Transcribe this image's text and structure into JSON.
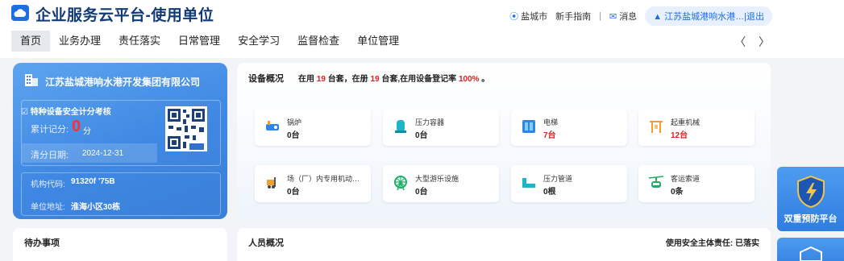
{
  "header": {
    "title": "企业服务云平台-使用单位",
    "location": "盐城市",
    "guide": "新手指南",
    "separator": "|",
    "message": "消息",
    "user": "江苏盐城港响水港…",
    "logout": "|退出"
  },
  "nav": {
    "items": [
      "首页",
      "业务办理",
      "责任落实",
      "日常管理",
      "安全学习",
      "监督检查",
      "单位管理"
    ],
    "arrows": "〈 〉"
  },
  "company": {
    "name": "江苏盐城港响水港开发集团有限公司",
    "assess_title": "特种设备安全计分考核",
    "score_label": "累计记分:",
    "score_value": "0",
    "score_unit": "分",
    "clear_label": "清分日期:",
    "clear_date": "2024-12-31",
    "org_label": "机构代码:",
    "org_code": "91320f        '75B",
    "addr_label": "单位地址:",
    "addr_value": "淮海小区30栋"
  },
  "equipment": {
    "title": "设备概况",
    "summary_prefix": "在用",
    "in_use": "19",
    "summary_mid1": "台套，在册",
    "registered": "19",
    "summary_mid2": "台套,在用设备登记率",
    "rate": "100%",
    "summary_suffix": "。"
  },
  "chart_data": {
    "type": "table",
    "categories": [
      "锅炉",
      "压力容器",
      "电梯",
      "起重机械",
      "场（厂）内专用机动…",
      "大型游乐设施",
      "压力管道",
      "客运索道"
    ],
    "values": [
      0,
      0,
      7,
      12,
      0,
      0,
      0,
      0
    ],
    "counts": [
      "0台",
      "0台",
      "7台",
      "12台",
      "0台",
      "0台",
      "0根",
      "0条"
    ],
    "highlight_color": "#e02020"
  },
  "todo": {
    "title": "待办事项"
  },
  "personnel": {
    "title": "人员概况",
    "responsibility": "使用安全主体责任: 已落实"
  },
  "float": {
    "label": "双重预防平台"
  },
  "colors": {
    "primary": "#1d6fe0",
    "card_blue": "#3f88e3",
    "alert_red": "#e02020"
  }
}
